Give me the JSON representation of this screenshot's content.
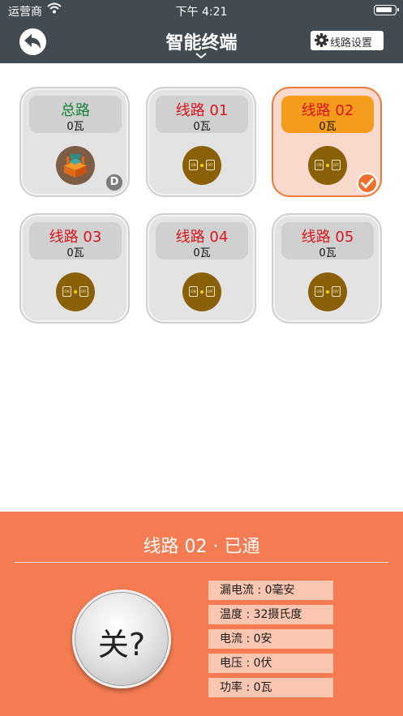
{
  "status_bar": {
    "carrier": "运营商",
    "time": "下午 4:21"
  },
  "nav": {
    "title": "智能终端",
    "settings_label": "线路设置"
  },
  "tiles": [
    {
      "name": "总路",
      "power": "0瓦",
      "icon": "relay-icon",
      "badge": "D"
    },
    {
      "name": "线路 01",
      "power": "0瓦",
      "icon": "switch-icon"
    },
    {
      "name": "线路 02",
      "power": "0瓦",
      "icon": "switch-icon",
      "selected": true
    },
    {
      "name": "线路 03",
      "power": "0瓦",
      "icon": "switch-icon"
    },
    {
      "name": "线路 04",
      "power": "0瓦",
      "icon": "switch-icon"
    },
    {
      "name": "线路 05",
      "power": "0瓦",
      "icon": "switch-icon"
    }
  ],
  "switch_icon": {
    "on_label": "ON",
    "off_label": "OFF"
  },
  "panel": {
    "title": "线路 02 · 已通",
    "toggle_label": "关?",
    "stats": [
      "漏电流 : 0毫安",
      "温度 : 32摄氏度",
      "电流 : 0安",
      "电压 : 0伏",
      "功率 : 0瓦"
    ]
  },
  "colors": {
    "nav": "#424b52",
    "panel": "#f57c52",
    "accent": "#ec7a3a",
    "selected_header": "#f59c1d",
    "line_name": "#d7161c",
    "main_name": "#17803a"
  }
}
